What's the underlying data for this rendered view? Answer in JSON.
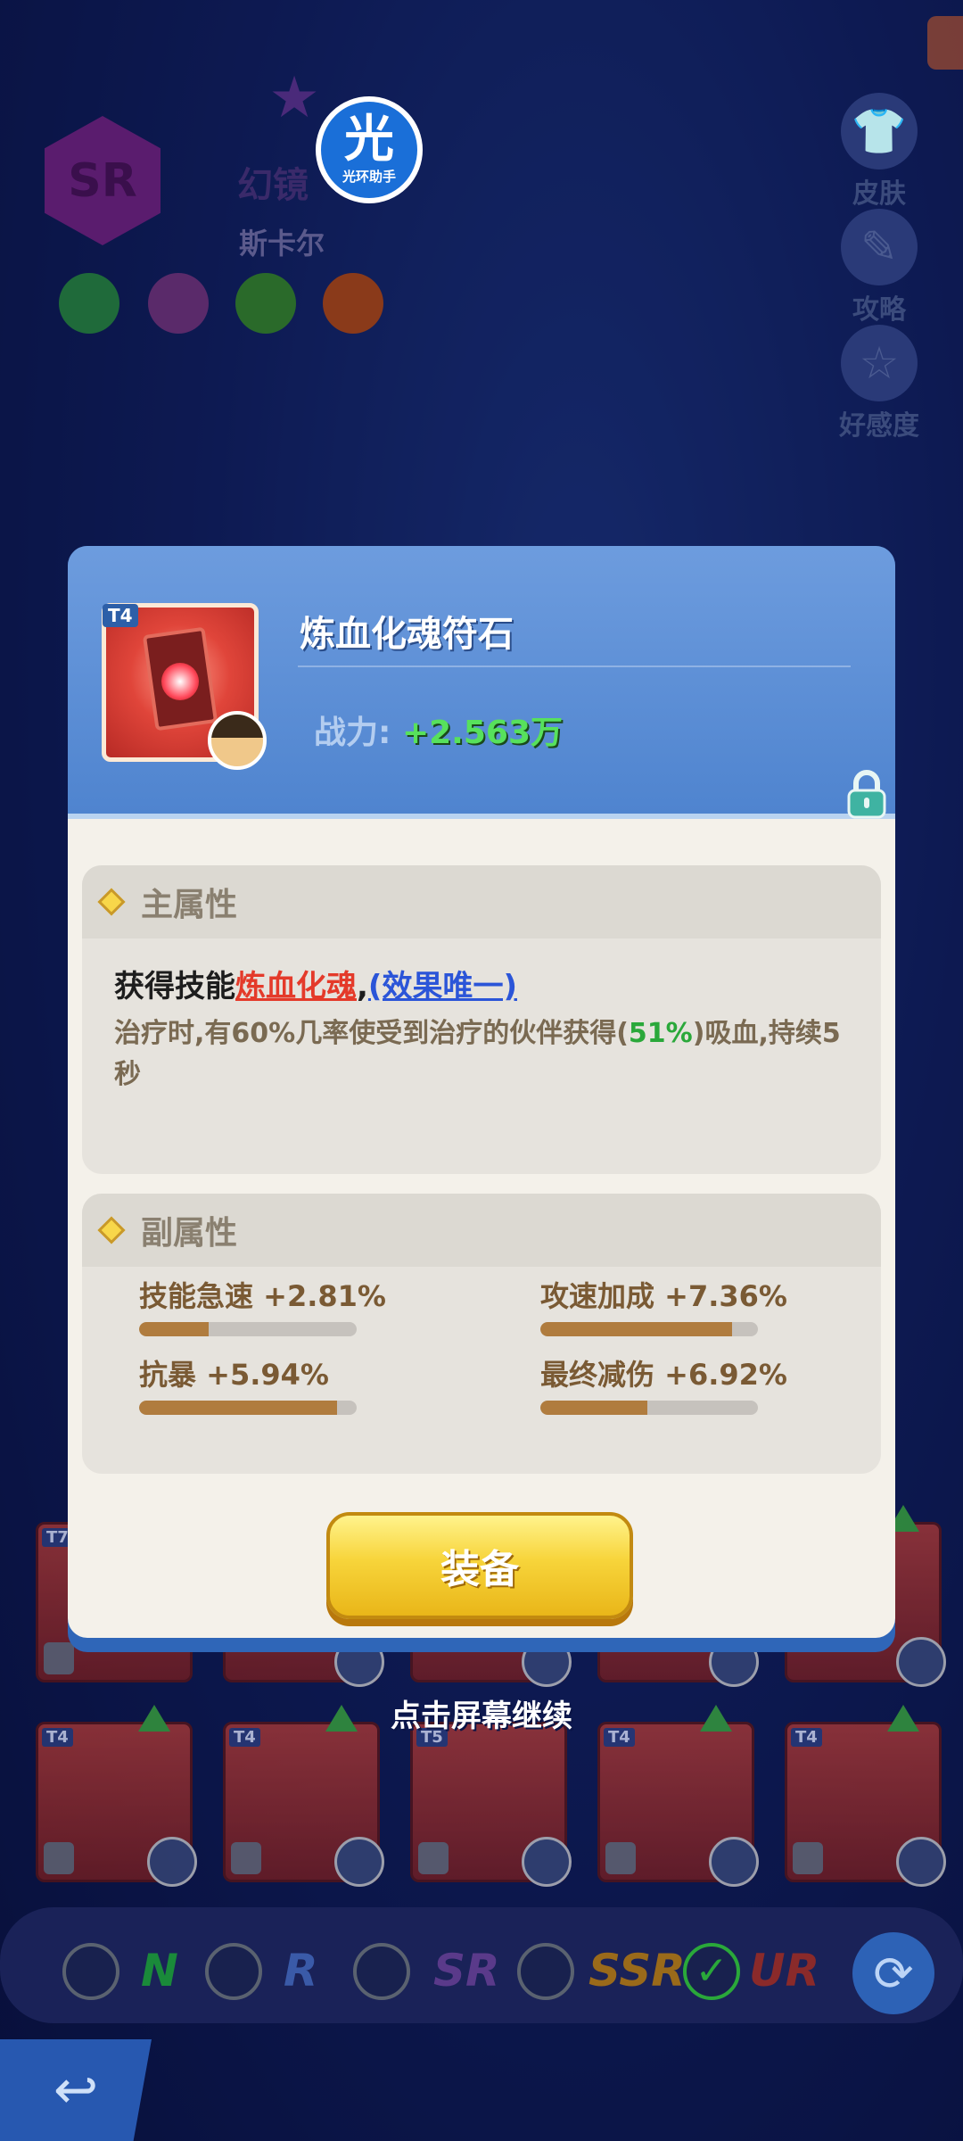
{
  "hero": {
    "rarity": "SR",
    "name": "幻镜",
    "subtitle": "斯卡尔"
  },
  "assistant_badge": {
    "icon_char": "光",
    "label": "光环助手"
  },
  "side_buttons": [
    {
      "label": "皮肤",
      "icon": "shirt-icon"
    },
    {
      "label": "攻略",
      "icon": "guide-icon"
    },
    {
      "label": "好感度",
      "icon": "star-icon"
    }
  ],
  "item": {
    "tier": "T4",
    "name": "炼血化魂符石",
    "power_label": "战力:",
    "power_value": "+2.563万"
  },
  "main_attribute": {
    "title": "主属性",
    "line_prefix": "获得技能",
    "skill_name": "炼血化魂",
    "separator": ",",
    "unique_tag": "(效果唯一)",
    "desc_part1": "治疗时,有60%几率使受到治疗的伙伴获得(",
    "desc_pct": "51%",
    "desc_part2": ")吸血,持续5秒"
  },
  "sub_attribute": {
    "title": "副属性",
    "stats": [
      {
        "label": "技能急速 +2.81%",
        "level": 0.32
      },
      {
        "label": "攻速加成 +7.36%",
        "level": 0.88
      },
      {
        "label": "抗暴 +5.94%",
        "level": 0.91
      },
      {
        "label": "最终减伤 +6.92%",
        "level": 0.49
      }
    ]
  },
  "equip_button": "装备",
  "tap_hint": "点击屏幕继续",
  "card_grid": {
    "row1_tiers": [
      "T7",
      "",
      "",
      "",
      ""
    ],
    "row2_tiers": [
      "T4",
      "T4",
      "T5",
      "T4",
      "T4"
    ]
  },
  "rarity_filters": [
    {
      "label": "N",
      "color": "#1a8a3a",
      "checked": false
    },
    {
      "label": "R",
      "color": "#3a5aa8",
      "checked": false
    },
    {
      "label": "SR",
      "color": "#5a3a8a",
      "checked": false
    },
    {
      "label": "SSR",
      "color": "#9a6a1a",
      "checked": false
    },
    {
      "label": "UR",
      "color": "#8a2a2a",
      "checked": true
    }
  ],
  "colors": {
    "header_blue": "#4f84cf",
    "power_green": "#57e15c",
    "skill_red": "#e43a2a",
    "unique_blue": "#2b55d8",
    "bar_fill": "#b07c3e",
    "button_yellow": "#f7d43a"
  }
}
